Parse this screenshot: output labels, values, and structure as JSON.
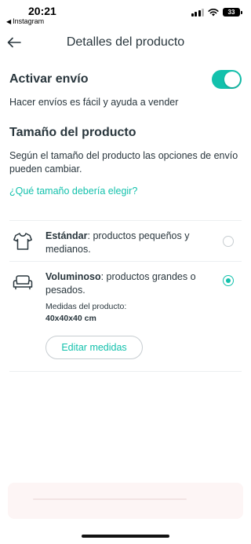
{
  "status_bar": {
    "time": "20:21",
    "back_app": "Instagram",
    "battery": "33"
  },
  "header": {
    "title": "Detalles del producto"
  },
  "shipping": {
    "title": "Activar envío",
    "enabled": true,
    "description": "Hacer envíos es fácil y ayuda a vender"
  },
  "size": {
    "title": "Tamaño del producto",
    "description": "Según el tamaño del producto las opciones de envío pueden cambiar.",
    "help_link": "¿Qué tamaño debería elegir?"
  },
  "options": [
    {
      "icon": "tshirt-icon",
      "name": "Estándar",
      "detail": ": productos pequeños y medianos.",
      "selected": false
    },
    {
      "icon": "sofa-icon",
      "name": "Voluminoso",
      "detail": ": productos grandes o pesados.",
      "selected": true,
      "measures_label": "Medidas del producto:",
      "measures_value": "40x40x40 cm",
      "edit_label": "Editar medidas"
    }
  ],
  "colors": {
    "accent": "#13c1ac",
    "text": "#29363d",
    "divider": "#eceff1"
  }
}
